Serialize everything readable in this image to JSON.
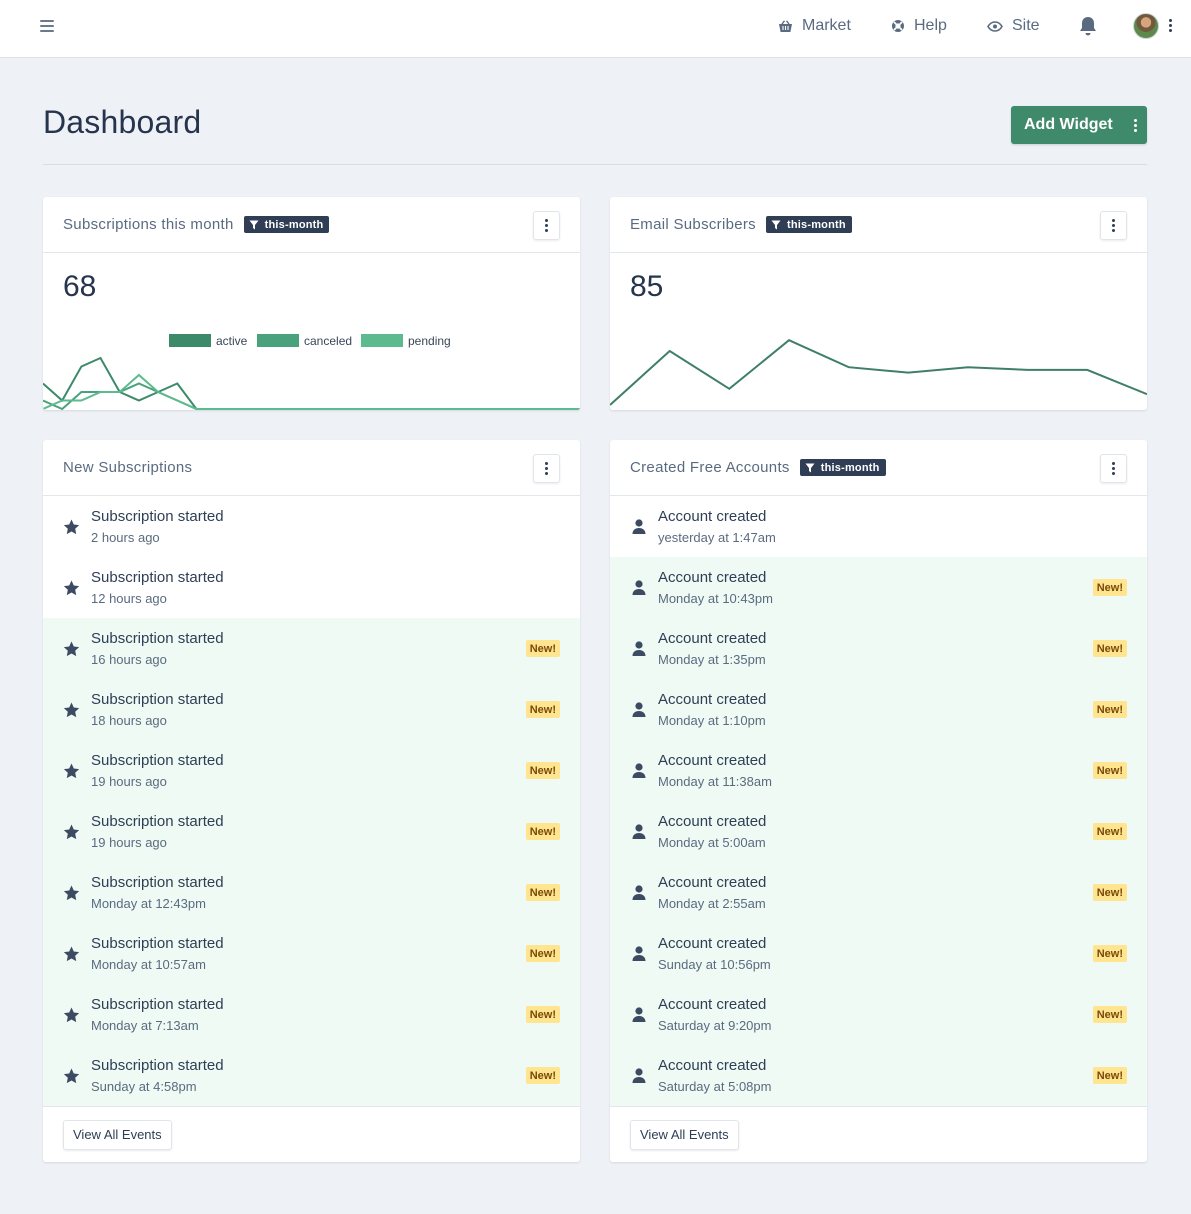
{
  "topbar": {
    "nav": [
      {
        "label": "Market",
        "icon": "basket-icon"
      },
      {
        "label": "Help",
        "icon": "lifebuoy-icon"
      },
      {
        "label": "Site",
        "icon": "eye-icon"
      }
    ]
  },
  "page": {
    "title": "Dashboard",
    "add_widget_label": "Add Widget"
  },
  "colors": {
    "brand_green": "#3f8a6a",
    "navy": "#2f3e55",
    "new_highlight": "#effaf4",
    "new_badge": "#ffe58f"
  },
  "widgets": {
    "subscriptions": {
      "title": "Subscriptions this month",
      "filter": "this-month",
      "value": "68"
    },
    "email": {
      "title": "Email Subscribers",
      "filter": "this-month",
      "value": "85"
    },
    "new_subs": {
      "title": "New Subscriptions",
      "view_all": "View All Events",
      "items": [
        {
          "title": "Subscription started",
          "time": "2 hours ago",
          "new": ""
        },
        {
          "title": "Subscription started",
          "time": "12 hours ago",
          "new": ""
        },
        {
          "title": "Subscription started",
          "time": "16 hours ago",
          "new": "New!"
        },
        {
          "title": "Subscription started",
          "time": "18 hours ago",
          "new": "New!"
        },
        {
          "title": "Subscription started",
          "time": "19 hours ago",
          "new": "New!"
        },
        {
          "title": "Subscription started",
          "time": "19 hours ago",
          "new": "New!"
        },
        {
          "title": "Subscription started",
          "time": "Monday at 12:43pm",
          "new": "New!"
        },
        {
          "title": "Subscription started",
          "time": "Monday at 10:57am",
          "new": "New!"
        },
        {
          "title": "Subscription started",
          "time": "Monday at 7:13am",
          "new": "New!"
        },
        {
          "title": "Subscription started",
          "time": "Sunday at 4:58pm",
          "new": "New!"
        }
      ]
    },
    "free_accounts": {
      "title": "Created Free Accounts",
      "filter": "this-month",
      "view_all": "View All Events",
      "items": [
        {
          "title": "Account created",
          "time": "yesterday at 1:47am",
          "new": ""
        },
        {
          "title": "Account created",
          "time": "Monday at 10:43pm",
          "new": "New!"
        },
        {
          "title": "Account created",
          "time": "Monday at 1:35pm",
          "new": "New!"
        },
        {
          "title": "Account created",
          "time": "Monday at 1:10pm",
          "new": "New!"
        },
        {
          "title": "Account created",
          "time": "Monday at 11:38am",
          "new": "New!"
        },
        {
          "title": "Account created",
          "time": "Monday at 5:00am",
          "new": "New!"
        },
        {
          "title": "Account created",
          "time": "Monday at 2:55am",
          "new": "New!"
        },
        {
          "title": "Account created",
          "time": "Sunday at 10:56pm",
          "new": "New!"
        },
        {
          "title": "Account created",
          "time": "Saturday at 9:20pm",
          "new": "New!"
        },
        {
          "title": "Account created",
          "time": "Saturday at 5:08pm",
          "new": "New!"
        }
      ]
    }
  },
  "chart_data": [
    {
      "type": "line",
      "legend": [
        "active",
        "canceled",
        "pending"
      ],
      "legend_colors": [
        "#3d8a6b",
        "#4aa27c",
        "#5cbb8e"
      ],
      "series": [
        {
          "name": "active",
          "values": [
            3,
            1,
            5,
            6,
            2,
            1,
            2,
            3,
            0,
            0,
            0,
            0,
            0,
            0,
            0,
            0,
            0,
            0,
            0,
            0,
            0,
            0,
            0,
            0,
            0,
            0,
            0,
            0,
            0
          ]
        },
        {
          "name": "canceled",
          "values": [
            1,
            0,
            2,
            2,
            2,
            3,
            2,
            1,
            0,
            0,
            0,
            0,
            0,
            0,
            0,
            0,
            0,
            0,
            0,
            0,
            0,
            0,
            0,
            0,
            0,
            0,
            0,
            0,
            0
          ]
        },
        {
          "name": "pending",
          "values": [
            0,
            1,
            1,
            2,
            2,
            4,
            2,
            1,
            0,
            0,
            0,
            0,
            0,
            0,
            0,
            0,
            0,
            0,
            0,
            0,
            0,
            0,
            0,
            0,
            0,
            0,
            0,
            0,
            0
          ]
        }
      ]
    },
    {
      "type": "line",
      "series": [
        {
          "name": "",
          "values": [
            0,
            10,
            3,
            12,
            7,
            6,
            7,
            6.5,
            6.5,
            2
          ]
        }
      ]
    }
  ]
}
